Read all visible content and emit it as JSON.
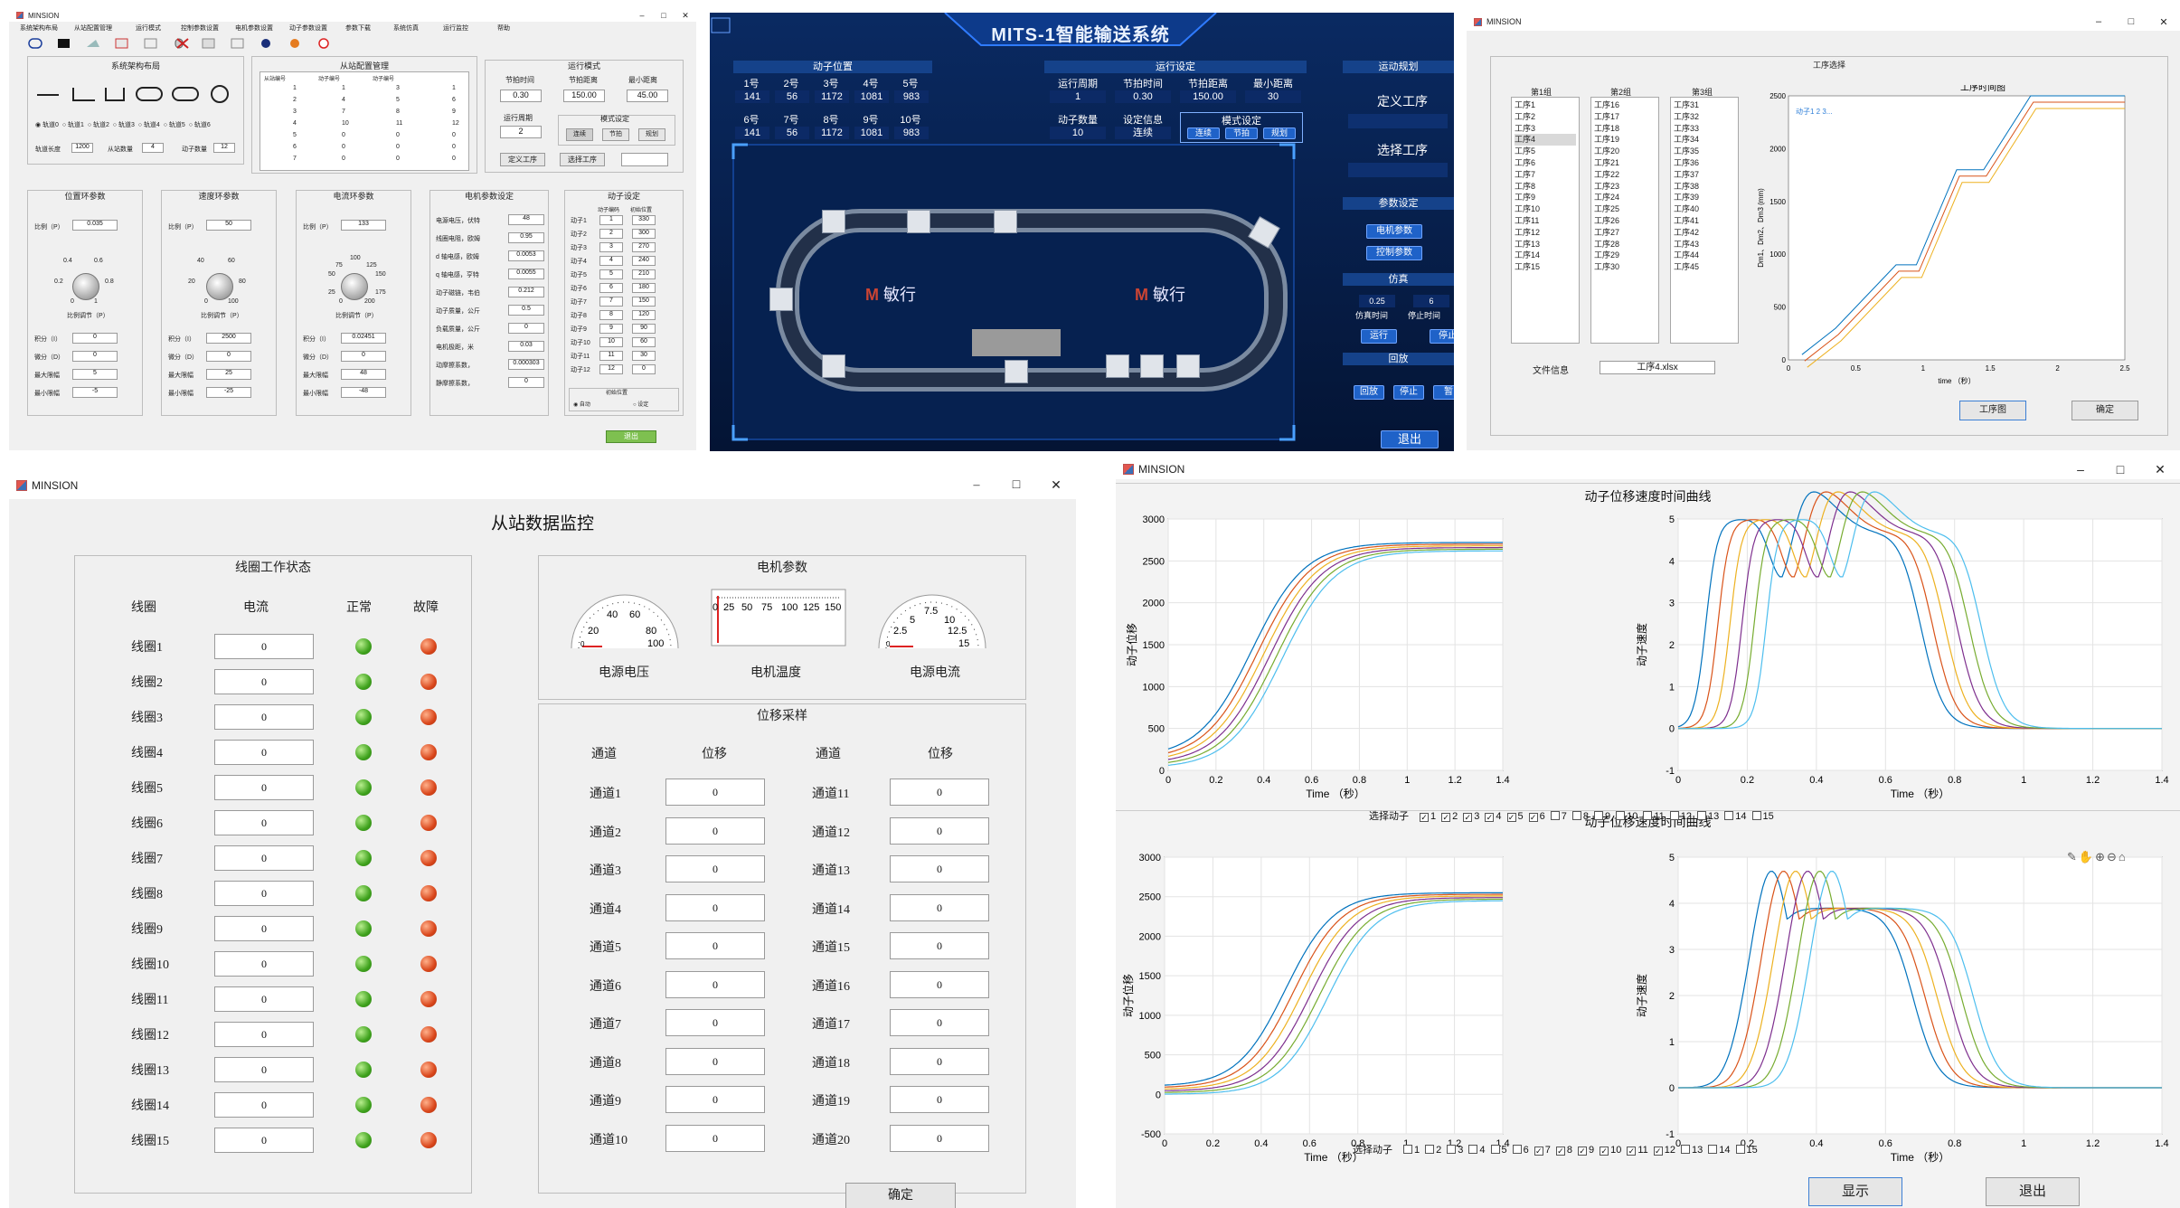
{
  "w1": {
    "title": "MINSION",
    "menu": [
      "系统架构布局",
      "从站配置管理",
      "运行模式",
      "控制参数设置",
      "电机参数设置",
      "动子参数设置",
      "参数下载",
      "系统仿真",
      "运行监控",
      "帮助"
    ],
    "layout": {
      "title": "系统架构布局",
      "radios": [
        "轨道0",
        "轨道1",
        "轨道2",
        "轨道3",
        "轨道4",
        "轨道5",
        "轨道6"
      ],
      "f1": "轨道长度",
      "v1": "1200",
      "f2": "从站数量",
      "v2": "4",
      "f3": "动子数量",
      "v3": "12"
    },
    "slave": {
      "title": "从站配置管理",
      "cols": [
        "从站编号",
        "动子编号",
        "动子编号"
      ],
      "rows": [
        [
          "1",
          "1",
          "3",
          "1"
        ],
        [
          "2",
          "4",
          "5",
          "6"
        ],
        [
          "3",
          "7",
          "8",
          "9"
        ],
        [
          "4",
          "10",
          "11",
          "12"
        ],
        [
          "5",
          "0",
          "0",
          "0"
        ],
        [
          "6",
          "0",
          "0",
          "0"
        ],
        [
          "7",
          "0",
          "0",
          "0"
        ]
      ]
    },
    "mode": {
      "title": "运行模式",
      "h1": "节拍时间",
      "h2": "节拍距离",
      "h3": "最小距离",
      "v1": "0.30",
      "v2": "150.00",
      "v3": "45.00",
      "period": "运行周期",
      "pv": "2",
      "sub": "模式设定",
      "b1": "连续",
      "b2": "节拍",
      "b3": "规划",
      "def": "定义工序",
      "pick": "选择工序"
    },
    "pos": {
      "title": "位置环参数",
      "p": "比例（P）",
      "pv": "0.035",
      "knob": "比例调节（P）",
      "scale": [
        "0.4",
        "0.6",
        "0.2",
        "0.8",
        "0",
        "1"
      ],
      "labels": [
        "积分（I）",
        "微分（D）",
        "最大限幅",
        "最小限幅"
      ],
      "vals": [
        "0",
        "0",
        "5",
        "-5"
      ]
    },
    "spd": {
      "title": "速度环参数",
      "p": "比例（P）",
      "pv": "50",
      "knob": "比例调节（P）",
      "scale": [
        "40",
        "60",
        "20",
        "80",
        "0",
        "100"
      ],
      "labels": [
        "积分（I）",
        "微分（D）",
        "最大限幅",
        "最小限幅"
      ],
      "vals": [
        "2500",
        "0",
        "25",
        "-25"
      ]
    },
    "cur": {
      "title": "电流环参数",
      "p": "比例（P）",
      "pv": "133",
      "knob": "比例调节（P）",
      "scale": [
        "100",
        "75",
        "125",
        "50",
        "150",
        "25",
        "175",
        "0",
        "200"
      ],
      "labels": [
        "积分（I）",
        "微分（D）",
        "最大限幅",
        "最小限幅"
      ],
      "vals": [
        "0.02451",
        "0",
        "48",
        "-48"
      ]
    },
    "motor": {
      "title": "电机参数设定",
      "labels": [
        "电源电压，伏特",
        "线圈电阻，欧姆",
        "d 轴电感，欧姆",
        "q 轴电感，亨特",
        "动子磁链，韦伯",
        "动子质量，公斤",
        "负载质量，公斤",
        "电机极距，米",
        "动摩擦系数，",
        "静摩擦系数，"
      ],
      "vals": [
        "48",
        "0.95",
        "0.0053",
        "0.0055",
        "0.212",
        "0.5",
        "0",
        "0.03",
        "0.000303",
        "0"
      ]
    },
    "mover": {
      "title": "动子设定",
      "h1": "动子编码",
      "h2": "初始位置",
      "rows": [
        [
          "动子1",
          "1",
          "330"
        ],
        [
          "动子2",
          "2",
          "300"
        ],
        [
          "动子3",
          "3",
          "270"
        ],
        [
          "动子4",
          "4",
          "240"
        ],
        [
          "动子5",
          "5",
          "210"
        ],
        [
          "动子6",
          "6",
          "180"
        ],
        [
          "动子7",
          "7",
          "150"
        ],
        [
          "动子8",
          "8",
          "120"
        ],
        [
          "动子9",
          "9",
          "90"
        ],
        [
          "动子10",
          "10",
          "60"
        ],
        [
          "动子11",
          "11",
          "30"
        ],
        [
          "动子12",
          "12",
          "0"
        ]
      ],
      "init": "初始位置",
      "auto": "自动",
      "set": "设定"
    },
    "exit": "退出"
  },
  "w2": {
    "title": "MITS-1智能输送系统",
    "pos": {
      "title": "动子位置",
      "labels": [
        "1号",
        "2号",
        "3号",
        "4号",
        "5号",
        "6号",
        "7号",
        "8号",
        "9号",
        "10号"
      ],
      "vals": [
        "141",
        "56",
        "1172",
        "1081",
        "983",
        "141",
        "56",
        "1172",
        "1081",
        "983"
      ]
    },
    "run": {
      "title": "运行设定",
      "h": [
        "运行周期",
        "节拍时间",
        "节拍距离",
        "最小距离"
      ],
      "v": [
        "1",
        "0.30",
        "150.00",
        "30"
      ],
      "h2": [
        "动子数量",
        "设定信息"
      ],
      "v2": [
        "10",
        "连续"
      ],
      "mode": "模式设定",
      "b": [
        "连续",
        "节拍",
        "规划"
      ]
    },
    "plan": {
      "title": "运动规划",
      "b1": "定义工序",
      "b2": "选择工序"
    },
    "param": {
      "title": "参数设定",
      "b1": "电机参数",
      "b2": "控制参数"
    },
    "sim": {
      "title": "仿真",
      "v1": "0.25",
      "v2": "6",
      "l1": "仿真时间",
      "l2": "停止时间",
      "b1": "运行",
      "b2": "停止"
    },
    "replay": {
      "title": "回放",
      "b": [
        "回放",
        "停止",
        "暂"
      ]
    },
    "exit": "退出",
    "logo": "敏行"
  },
  "w3": {
    "title": "MINSION",
    "group": "工序选择",
    "cols": [
      "第1组",
      "第2组",
      "第3组"
    ],
    "list1": [
      "工序1",
      "工序2",
      "工序3",
      "工序4",
      "工序5",
      "工序6",
      "工序7",
      "工序8",
      "工序9",
      "工序10",
      "工序11",
      "工序12",
      "工序13",
      "工序14",
      "工序15"
    ],
    "list2": [
      "工序16",
      "工序17",
      "工序18",
      "工序19",
      "工序20",
      "工序21",
      "工序22",
      "工序23",
      "工序24",
      "工序25",
      "工序26",
      "工序27",
      "工序28",
      "工序29",
      "工序30"
    ],
    "list3": [
      "工序31",
      "工序32",
      "工序33",
      "工序34",
      "工序35",
      "工序36",
      "工序37",
      "工序38",
      "工序39",
      "工序40",
      "工序41",
      "工序42",
      "工序43",
      "工序44",
      "工序45"
    ],
    "file_label": "文件信息",
    "file": "工序4.xlsx",
    "chart_title": "工序时间图",
    "legend": "动子1 2 3...",
    "xlabel": "time （秒）",
    "ylabel": "Dm1、Dm2、Dm3 (mm)",
    "btn1": "工序图",
    "btn2": "确定"
  },
  "w4": {
    "title": "MINSION",
    "heading": "从站数据监控",
    "coil_group": "线圈工作状态",
    "coil_cols": [
      "线圈",
      "电流",
      "正常",
      "故障"
    ],
    "coils": [
      "线圈1",
      "线圈2",
      "线圈3",
      "线圈4",
      "线圈5",
      "线圈6",
      "线圈7",
      "线圈8",
      "线圈9",
      "线圈10",
      "线圈11",
      "线圈12",
      "线圈13",
      "线圈14",
      "线圈15"
    ],
    "zero": "0",
    "motor_group": "电机参数",
    "g1": "电源电压",
    "g2": "电机温度",
    "g3": "电源电流",
    "g1s": [
      "20",
      "40",
      "60",
      "80",
      "100",
      "0"
    ],
    "g2s": [
      "0",
      "25",
      "50",
      "75",
      "100",
      "125",
      "150"
    ],
    "g3s": [
      "2.5",
      "5",
      "7.5",
      "10",
      "12.5",
      "15",
      "0"
    ],
    "disp_group": "位移采样",
    "disp_cols": [
      "通道",
      "位移",
      "通道",
      "位移"
    ],
    "ch1": [
      "通道1",
      "通道2",
      "通道3",
      "通道4",
      "通道5",
      "通道6",
      "通道7",
      "通道8",
      "通道9",
      "通道10"
    ],
    "ch2": [
      "通道11",
      "通道12",
      "通道13",
      "通道14",
      "通道15",
      "通道16",
      "通道17",
      "通道18",
      "通道19",
      "通道20"
    ],
    "ok": "确定"
  },
  "w5": {
    "title": "MINSION",
    "t1": "动子位移速度时间曲线",
    "t2": "动子位移速度时间曲线",
    "ylab_pos": "动子位移",
    "ylab_vel": "动子速度",
    "xlabel": "Time （秒）",
    "sel": "选择动子",
    "checks": [
      "1",
      "2",
      "3",
      "4",
      "5",
      "6",
      "7",
      "8",
      "9",
      "10",
      "11",
      "12",
      "13",
      "14",
      "15"
    ],
    "checked_top": [
      1,
      2,
      3,
      4,
      5,
      6
    ],
    "checked_bot": [
      7,
      8,
      9,
      10,
      11,
      12
    ],
    "btn1": "显示",
    "btn2": "退出"
  },
  "chart_data": [
    {
      "type": "line",
      "xlabel": "Time （秒）",
      "ylabel": "动子位移",
      "xlim": [
        0,
        1.4
      ],
      "ylim": [
        0,
        3000
      ],
      "series_count": 6,
      "start": [
        150,
        0
      ],
      "end": [
        2720,
        2620
      ]
    },
    {
      "type": "line",
      "xlabel": "Time （秒）",
      "ylabel": "动子速度",
      "xlim": [
        0,
        1.4
      ],
      "ylim": [
        -1,
        5
      ],
      "series_count": 6,
      "peak": 5
    },
    {
      "type": "line",
      "xlabel": "Time （秒）",
      "ylabel": "动子位移",
      "xlim": [
        0,
        1.4
      ],
      "ylim": [
        -500,
        3000
      ],
      "series_count": 6,
      "start": [
        100,
        0
      ],
      "end": [
        2550,
        2450
      ]
    },
    {
      "type": "line",
      "xlabel": "Time （秒）",
      "ylabel": "动子速度",
      "xlim": [
        0,
        1.4
      ],
      "ylim": [
        -1,
        5
      ],
      "series_count": 6,
      "peak": 4.7
    },
    {
      "type": "line",
      "title": "工序时间图",
      "xlabel": "time （秒）",
      "ylabel": "Dm1、Dm2、Dm3 (mm)",
      "xlim": [
        0,
        2.5
      ],
      "ylim": [
        0,
        2500
      ],
      "series_count": 3
    }
  ],
  "colors": {
    "series": [
      "#0072bd",
      "#d95319",
      "#edb120",
      "#7e2f8e",
      "#77ac30",
      "#4dbeee"
    ]
  }
}
